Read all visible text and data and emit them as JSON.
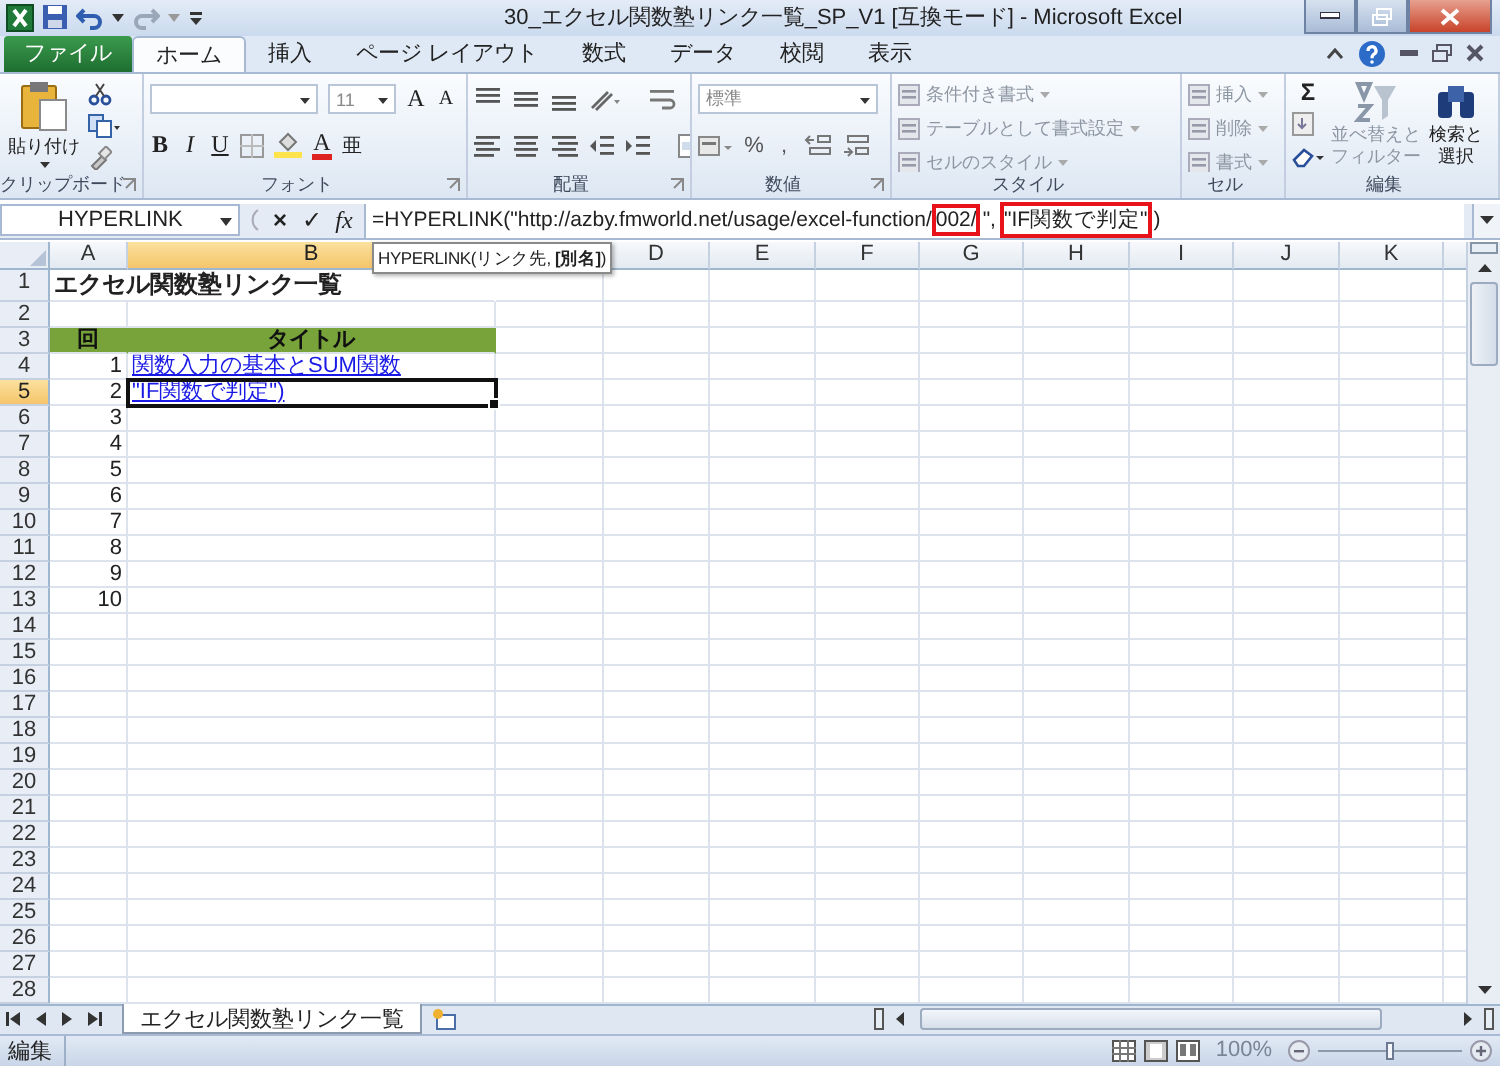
{
  "window": {
    "title": "30_エクセル関数塾リンク一覧_SP_V1 [互換モード] - Microsoft Excel"
  },
  "ribbon_tabs": [
    {
      "label": "ファイル",
      "kind": "file",
      "selected": false
    },
    {
      "label": "ホーム",
      "kind": "tab",
      "selected": true
    },
    {
      "label": "挿入",
      "kind": "tab",
      "selected": false
    },
    {
      "label": "ページ レイアウト",
      "kind": "tab",
      "selected": false
    },
    {
      "label": "数式",
      "kind": "tab",
      "selected": false
    },
    {
      "label": "データ",
      "kind": "tab",
      "selected": false
    },
    {
      "label": "校閲",
      "kind": "tab",
      "selected": false
    },
    {
      "label": "表示",
      "kind": "tab",
      "selected": false
    }
  ],
  "ribbon_groups": [
    {
      "kind": "clipboard",
      "label": "クリップボード",
      "paste": "貼り付け"
    },
    {
      "kind": "font",
      "label": "フォント",
      "font_size": "11",
      "grow": "A",
      "shrink": "A",
      "styles": [
        "B",
        "I",
        "U"
      ],
      "font_color": "A",
      "phonetic": "亜"
    },
    {
      "kind": "alignment",
      "label": "配置"
    },
    {
      "kind": "number",
      "label": "数値",
      "format": "標準",
      "symbols": [
        "%",
        ","
      ]
    },
    {
      "kind": "list",
      "label": "スタイル",
      "items": [
        {
          "label": "条件付き書式",
          "disabled": true
        },
        {
          "label": "テーブルとして書式設定",
          "disabled": true
        },
        {
          "label": "セルのスタイル",
          "disabled": true
        }
      ]
    },
    {
      "kind": "list",
      "label": "セル",
      "items": [
        {
          "label": "挿入",
          "disabled": true
        },
        {
          "label": "削除",
          "disabled": true
        },
        {
          "label": "書式",
          "disabled": true
        }
      ]
    },
    {
      "kind": "editing",
      "label": "編集",
      "sum": "Σ",
      "items": [
        {
          "label": "並べ替えとフィルター",
          "disabled": true
        },
        {
          "label": "検索と選択",
          "disabled": false
        }
      ]
    }
  ],
  "formula_bar": {
    "name_box": "HYPERLINK",
    "buttons": [
      "×",
      "✓",
      "fx"
    ],
    "segments": [
      {
        "text": "=HYPERLINK(\"http://azby.fmworld.net/usage/excel-function/",
        "highlighted": false
      },
      {
        "text": "002/",
        "highlighted": true
      },
      {
        "text": "\",",
        "highlighted": false
      },
      {
        "text": "\"IF関数で判定\"",
        "highlighted": true
      },
      {
        "text": ")",
        "highlighted": false
      }
    ]
  },
  "tooltip": "HYPERLINK(リンク先, **[別名]**)",
  "sheet": {
    "columns": [
      {
        "label": "A",
        "selected": false
      },
      {
        "label": "B",
        "selected": true
      },
      {},
      {
        "label": "D",
        "selected": false
      },
      {
        "label": "E",
        "selected": false
      },
      {
        "label": "F",
        "selected": false
      },
      {
        "label": "G",
        "selected": false
      },
      {
        "label": "H",
        "selected": false
      },
      {
        "label": "I",
        "selected": false
      },
      {
        "label": "J",
        "selected": false
      },
      {
        "label": "K",
        "selected": false
      },
      {
        "selected": false
      }
    ],
    "rows": [
      {
        "label": "1",
        "selected": false,
        "cells": [
          {
            "kind": "title",
            "text": "エクセル関数塾リンク一覧",
            "selected": false
          }
        ]
      },
      {
        "label": "2",
        "selected": false
      },
      {
        "label": "3",
        "selected": false,
        "cells": [
          {
            "kind": "header",
            "text": "回",
            "selected": false
          },
          {
            "kind": "header",
            "text": "タイトル",
            "selected": false
          }
        ]
      },
      {
        "label": "4",
        "selected": false,
        "cells": [
          {
            "kind": "number",
            "text": "1",
            "selected": false
          },
          {
            "kind": "link",
            "text": "関数入力の基本とSUM関数",
            "selected": false
          }
        ]
      },
      {
        "label": "5",
        "selected": true,
        "cells": [
          {
            "kind": "number",
            "text": "2",
            "selected": false
          },
          {
            "kind": "link",
            "text": "\"IF関数で判定\")",
            "selected": true
          }
        ]
      },
      {
        "label": "6",
        "selected": false,
        "cells": [
          {
            "kind": "number",
            "text": "3",
            "selected": false
          }
        ]
      },
      {
        "label": "7",
        "selected": false,
        "cells": [
          {
            "kind": "number",
            "text": "4",
            "selected": false
          }
        ]
      },
      {
        "label": "8",
        "selected": false,
        "cells": [
          {
            "kind": "number",
            "text": "5",
            "selected": false
          }
        ]
      },
      {
        "label": "9",
        "selected": false,
        "cells": [
          {
            "kind": "number",
            "text": "6",
            "selected": false
          }
        ]
      },
      {
        "label": "10",
        "selected": false,
        "cells": [
          {
            "kind": "number",
            "text": "7",
            "selected": false
          }
        ]
      },
      {
        "label": "11",
        "selected": false,
        "cells": [
          {
            "kind": "number",
            "text": "8",
            "selected": false
          }
        ]
      },
      {
        "label": "12",
        "selected": false,
        "cells": [
          {
            "kind": "number",
            "text": "9",
            "selected": false
          }
        ]
      },
      {
        "label": "13",
        "selected": false,
        "cells": [
          {
            "kind": "number",
            "text": "10",
            "selected": false
          }
        ]
      },
      {
        "label": "14",
        "selected": false
      },
      {
        "label": "15",
        "selected": false
      },
      {
        "label": "16",
        "selected": false
      },
      {
        "label": "17",
        "selected": false
      },
      {
        "label": "18",
        "selected": false
      },
      {
        "label": "19",
        "selected": false
      },
      {
        "label": "20",
        "selected": false
      },
      {
        "label": "21",
        "selected": false
      },
      {
        "label": "22",
        "selected": false
      },
      {
        "label": "23",
        "selected": false
      },
      {
        "label": "24",
        "selected": false
      },
      {
        "label": "25",
        "selected": false
      },
      {
        "label": "26",
        "selected": false
      },
      {
        "label": "27",
        "selected": false
      },
      {
        "label": "28",
        "selected": false
      }
    ]
  },
  "sheet_tabs": [
    {
      "label": "エクセル関数塾リンク一覧",
      "selected": true
    }
  ],
  "status_bar": {
    "mode": "編集",
    "zoom": "100%",
    "zoom_slider": {
      "level": 0.5
    }
  }
}
